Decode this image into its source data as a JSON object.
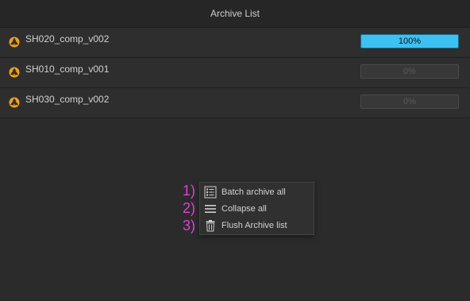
{
  "header": {
    "title": "Archive List"
  },
  "rows": [
    {
      "name": "SH020_comp_v002",
      "progress_label": "100%",
      "progress": 1.0,
      "icon": "nuke-icon"
    },
    {
      "name": "SH010_comp_v001",
      "progress_label": "0%",
      "progress": 0.0,
      "icon": "nuke-icon"
    },
    {
      "name": "SH030_comp_v002",
      "progress_label": "0%",
      "progress": 0.0,
      "icon": "nuke-icon"
    }
  ],
  "context_menu": {
    "items": [
      {
        "label": "Batch archive all",
        "icon": "checklist-icon",
        "callout": "1)"
      },
      {
        "label": "Collapse all",
        "icon": "hamburger-icon",
        "callout": "2)"
      },
      {
        "label": "Flush Archive list",
        "icon": "trash-icon",
        "callout": "3)"
      }
    ]
  },
  "colors": {
    "accent": "#3cc1f2",
    "callout": "#e13fd9",
    "icon": "#f0a21c"
  }
}
